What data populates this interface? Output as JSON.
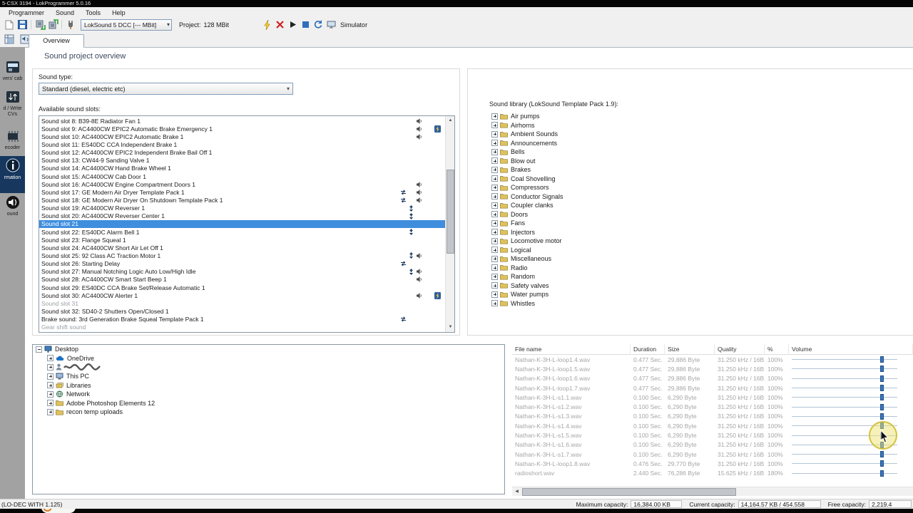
{
  "titlebar": {
    "title": "5-CSX 3194 - LokProgrammer 5.0.16"
  },
  "menubar": {
    "items": [
      "Programmer",
      "Sound",
      "Tools",
      "Help"
    ]
  },
  "toolbar": {
    "decoder_dropdown": "LokSound 5 DCC [--- MBit]",
    "project_label": "Project:",
    "project_value": "128 MBit",
    "simulator_label": "Simulator"
  },
  "tab": {
    "label": "Overview"
  },
  "page": {
    "title": "Sound project overview"
  },
  "sidebar": {
    "items": [
      {
        "label": "vers' cab",
        "icon": "drivers-cab-icon",
        "selected": false
      },
      {
        "label": "d / Write CVs",
        "icon": "read-write-cvs-icon",
        "selected": false
      },
      {
        "label": "ecoder",
        "icon": "decoder-icon",
        "selected": false
      },
      {
        "label": "rmation",
        "icon": "information-icon",
        "selected": true
      },
      {
        "label": "ound",
        "icon": "sound-icon",
        "selected": false
      }
    ]
  },
  "sound_type": {
    "label": "Sound type:",
    "value": "Standard (diesel, electric etc)"
  },
  "slots": {
    "label": "Available sound slots:",
    "items": [
      {
        "label": "Sound slot 8: B39-8E Radiator Fan 1",
        "icons": [
          "speaker"
        ],
        "flash": false
      },
      {
        "label": "Sound slot 9: AC4400CW EPIC2 Automatic Brake Emergency 1",
        "icons": [
          "speaker"
        ],
        "flash": true
      },
      {
        "label": "Sound slot 10: AC4400CW EPIC2 Automatic Brake 1",
        "icons": [
          "speaker"
        ],
        "flash": false
      },
      {
        "label": "Sound slot 11: ES40DC CCA Independent Brake 1",
        "icons": [],
        "flash": false
      },
      {
        "label": "Sound slot 12: AC4400CW EPIC2 Independent Brake Bail Off 1",
        "icons": [],
        "flash": false
      },
      {
        "label": "Sound slot 13: CW44-9 Sanding Valve 1",
        "icons": [],
        "flash": false
      },
      {
        "label": "Sound slot 14: AC4400CW Hand Brake Wheel 1",
        "icons": [],
        "flash": false
      },
      {
        "label": "Sound slot 15: AC4400CW Cab Door 1",
        "icons": [],
        "flash": false
      },
      {
        "label": "Sound slot 16: AC4400CW Engine Compartment Doors 1",
        "icons": [
          "speaker"
        ],
        "flash": false
      },
      {
        "label": "Sound slot 17: GE Modern Air Dryer Template Pack 1",
        "icons": [
          "loop",
          "speaker"
        ],
        "flash": false
      },
      {
        "label": "Sound slot 18: GE Modern Air Dryer On Shutdown Template Pack 1",
        "icons": [
          "loop",
          "speaker"
        ],
        "flash": false
      },
      {
        "label": "Sound slot 19: AC4400CW Reverser 1",
        "icons": [
          "updown"
        ],
        "flash": false
      },
      {
        "label": "Sound slot 20: AC4400CW Reverser Center 1",
        "icons": [
          "updown"
        ],
        "flash": false
      },
      {
        "label": "Sound slot 21",
        "icons": [],
        "flash": false,
        "selected": true
      },
      {
        "label": "Sound slot 22: ES40DC Alarm Bell 1",
        "icons": [
          "updown"
        ],
        "flash": false
      },
      {
        "label": "Sound slot 23: Flange Squeal 1",
        "icons": [],
        "flash": false
      },
      {
        "label": "Sound slot 24: AC4400CW Short Air Let Off 1",
        "icons": [],
        "flash": false
      },
      {
        "label": "Sound slot 25: 92 Class AC Traction Motor 1",
        "icons": [
          "updown",
          "speaker"
        ],
        "flash": false
      },
      {
        "label": "Sound slot 26: Starting Delay",
        "icons": [
          "loop"
        ],
        "flash": false
      },
      {
        "label": "Sound slot 27: Manual Notching Logic Auto Low/High Idle",
        "icons": [
          "updown",
          "speaker"
        ],
        "flash": false
      },
      {
        "label": "Sound slot 28: AC4400CW Smart Start Beep 1",
        "icons": [
          "speaker"
        ],
        "flash": false
      },
      {
        "label": "Sound slot 29: ES40DC CCA Brake Set/Release Automatic 1",
        "icons": [],
        "flash": false
      },
      {
        "label": "Sound slot 30: AC4400CW Alerter 1",
        "icons": [
          "speaker"
        ],
        "flash": true
      },
      {
        "label": "Sound slot 31",
        "icons": [],
        "flash": false,
        "disabled": true
      },
      {
        "label": "Sound slot 32: SD40-2 Shutters Open/Closed 1",
        "icons": [],
        "flash": false
      },
      {
        "label": "Brake sound: 3rd Generation Brake Squeal Template Pack 1",
        "icons": [
          "loop"
        ],
        "flash": false
      },
      {
        "label": "Gear shift sound",
        "icons": [],
        "flash": false,
        "disabled": true
      }
    ]
  },
  "library": {
    "label": "Sound library (LokSound Template Pack 1.9):",
    "folders": [
      "Air pumps",
      "Airhorns",
      "Ambient Sounds",
      "Announcements",
      "Bells",
      "Blow out",
      "Brakes",
      "Coal Shovelling",
      "Compressors",
      "Conductor Signals",
      "Coupler clanks",
      "Doors",
      "Fans",
      "Injectors",
      "Locomotive motor",
      "Logical",
      "Miscellaneous",
      "Radio",
      "Random",
      "Safety valves",
      "Water pumps",
      "Whistles"
    ]
  },
  "file_tree": {
    "items": [
      {
        "label": "Desktop",
        "icon": "desktop-icon",
        "level": 0,
        "expander": "minus",
        "redacted": false
      },
      {
        "label": "OneDrive",
        "icon": "onedrive-icon",
        "level": 1,
        "expander": "plus",
        "redacted": false
      },
      {
        "label": "",
        "icon": "user-icon",
        "level": 1,
        "expander": "plus",
        "redacted": true
      },
      {
        "label": "This PC",
        "icon": "computer-icon",
        "level": 1,
        "expander": "plus",
        "redacted": false
      },
      {
        "label": "Libraries",
        "icon": "libraries-icon",
        "level": 1,
        "expander": "plus",
        "redacted": false
      },
      {
        "label": "Network",
        "icon": "network-icon",
        "level": 1,
        "expander": "plus",
        "redacted": false
      },
      {
        "label": "Adobe Photoshop Elements 12",
        "icon": "folder-icon",
        "level": 1,
        "expander": "plus",
        "redacted": false
      },
      {
        "label": "recon temp uploads",
        "icon": "folder-icon",
        "level": 1,
        "expander": "plus",
        "redacted": false
      }
    ]
  },
  "file_table": {
    "columns": [
      "File name",
      "Duration",
      "Size",
      "Quality",
      "%",
      "Volume"
    ],
    "highlight_row": 8,
    "rows": [
      {
        "name": "Nathan-K-3H-L-loop1.4.wav",
        "duration": "0.477 Sec.",
        "size": "29,886 Byte",
        "quality": "31.250 kHz / 16B",
        "percent": "100%"
      },
      {
        "name": "Nathan-K-3H-L-loop1.5.wav",
        "duration": "0.477 Sec.",
        "size": "29,886 Byte",
        "quality": "31.250 kHz / 16B",
        "percent": "100%"
      },
      {
        "name": "Nathan-K-3H-L-loop1.6.wav",
        "duration": "0.477 Sec.",
        "size": "29,886 Byte",
        "quality": "31.250 kHz / 16B",
        "percent": "100%"
      },
      {
        "name": "Nathan-K-3H-L-loop1.7.wav",
        "duration": "0.477 Sec.",
        "size": "29,886 Byte",
        "quality": "31.250 kHz / 16B",
        "percent": "100%"
      },
      {
        "name": "Nathan-K-3H-L-s1.1.wav",
        "duration": "0.100 Sec.",
        "size": "6,290 Byte",
        "quality": "31.250 kHz / 16B",
        "percent": "100%"
      },
      {
        "name": "Nathan-K-3H-L-s1.2.wav",
        "duration": "0.100 Sec.",
        "size": "6,290 Byte",
        "quality": "31.250 kHz / 16B",
        "percent": "100%"
      },
      {
        "name": "Nathan-K-3H-L-s1.3.wav",
        "duration": "0.100 Sec.",
        "size": "6,290 Byte",
        "quality": "31.250 kHz / 16B",
        "percent": "100%"
      },
      {
        "name": "Nathan-K-3H-L-s1.4.wav",
        "duration": "0.100 Sec.",
        "size": "6,290 Byte",
        "quality": "31.250 kHz / 16B",
        "percent": "100%"
      },
      {
        "name": "Nathan-K-3H-L-s1.5.wav",
        "duration": "0.100 Sec.",
        "size": "6,290 Byte",
        "quality": "31.250 kHz / 16B",
        "percent": "100%"
      },
      {
        "name": "Nathan-K-3H-L-s1.6.wav",
        "duration": "0.100 Sec.",
        "size": "6,290 Byte",
        "quality": "31.250 kHz / 16B",
        "percent": "100%"
      },
      {
        "name": "Nathan-K-3H-L-s1.7.wav",
        "duration": "0.100 Sec.",
        "size": "6,290 Byte",
        "quality": "31.250 kHz / 16B",
        "percent": "100%"
      },
      {
        "name": "Nathan-K-3H-L-loop1.8.wav",
        "duration": "0.476 Sec.",
        "size": "29,770 Byte",
        "quality": "31.250 kHz / 16B",
        "percent": "100%"
      },
      {
        "name": "radioshort.wav",
        "duration": "2.440 Sec.",
        "size": "76,286 Byte",
        "quality": "15.625 kHz / 16B",
        "percent": "180%"
      }
    ]
  },
  "statusbar": {
    "overlay_text": "(LO-DEC WITH 1.125)",
    "max_label": "Maximum capacity:",
    "max_value": "16,384.00 KB",
    "current_label": "Current capacity:",
    "current_value": "14,164.57 KB / 454.558",
    "free_label": "Free capacity:",
    "free_value": "2,219.4"
  }
}
